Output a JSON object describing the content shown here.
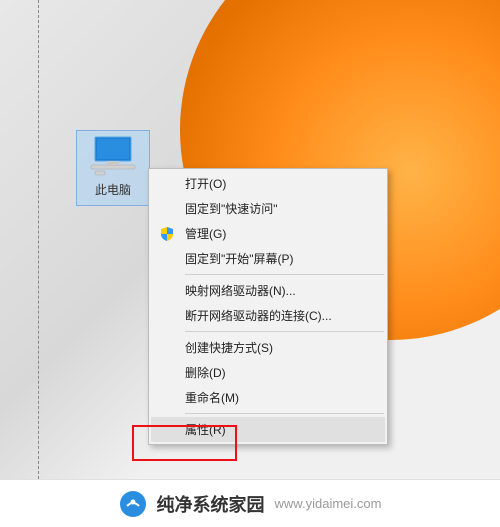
{
  "desktop": {
    "icon_label": "此电脑"
  },
  "menu": {
    "open": "打开(O)",
    "pin_quick_access": "固定到\"快速访问\"",
    "manage": "管理(G)",
    "pin_start": "固定到\"开始\"屏幕(P)",
    "map_network": "映射网络驱动器(N)...",
    "disconnect_network": "断开网络驱动器的连接(C)...",
    "create_shortcut": "创建快捷方式(S)",
    "delete": "删除(D)",
    "rename": "重命名(M)",
    "properties": "属性(R)"
  },
  "watermark": {
    "title": "纯净系统家园",
    "url": "www.yidaimei.com"
  }
}
